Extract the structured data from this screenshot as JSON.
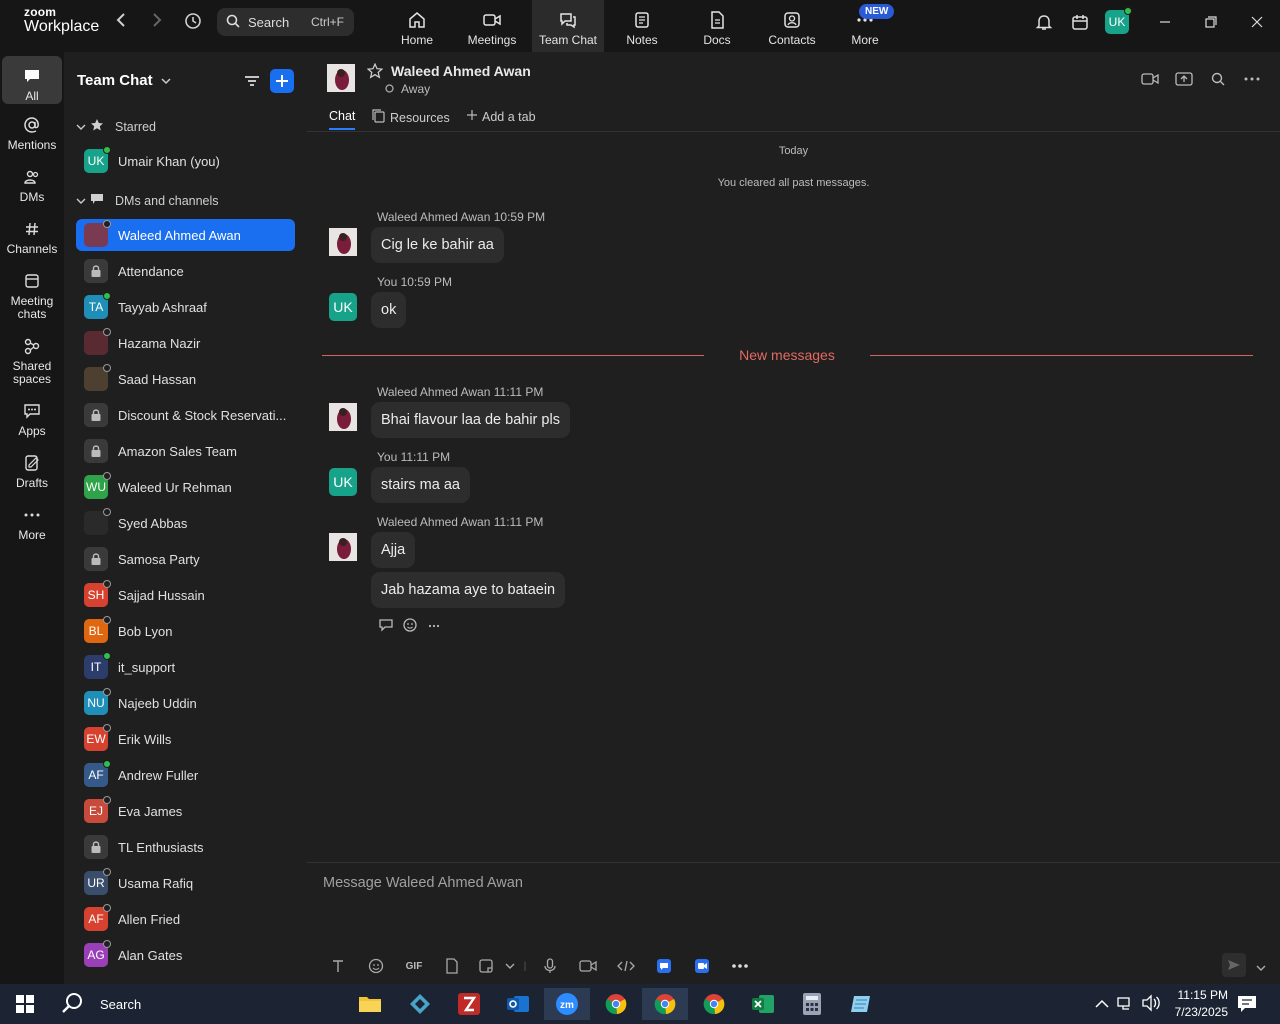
{
  "app": {
    "logo_top": "zoom",
    "logo_bottom": "Workplace",
    "search_label": "Search",
    "search_shortcut": "Ctrl+F",
    "tabs": [
      {
        "label": "Home"
      },
      {
        "label": "Meetings"
      },
      {
        "label": "Team Chat"
      },
      {
        "label": "Notes"
      },
      {
        "label": "Docs"
      },
      {
        "label": "Contacts"
      },
      {
        "label": "More"
      }
    ],
    "new_badge": "NEW",
    "user_initials": "UK"
  },
  "rail": [
    {
      "label": "All"
    },
    {
      "label": "Mentions"
    },
    {
      "label": "DMs"
    },
    {
      "label": "Channels"
    },
    {
      "label": "Meeting chats"
    },
    {
      "label": "Shared spaces"
    },
    {
      "label": "Apps"
    },
    {
      "label": "Drafts"
    },
    {
      "label": "More"
    }
  ],
  "sidebar": {
    "title": "Team Chat",
    "starred_label": "Starred",
    "dms_label": "DMs and channels",
    "starred": [
      {
        "name": "Umair Khan (you)",
        "initials": "UK",
        "color": "#17a28a",
        "status": "on"
      }
    ],
    "items": [
      {
        "name": "Waleed Ahmed Awan",
        "initials": "",
        "color": "#7a3b52",
        "status": "off"
      },
      {
        "name": "Attendance",
        "initials": "",
        "color": "",
        "status": ""
      },
      {
        "name": "Tayyab Ashraaf",
        "initials": "TA",
        "color": "#1f8fb8",
        "status": "on"
      },
      {
        "name": "Hazama Nazir",
        "initials": "",
        "color": "#5a2a33",
        "status": "off"
      },
      {
        "name": "Saad Hassan",
        "initials": "",
        "color": "#4d4030",
        "status": "off"
      },
      {
        "name": "Discount & Stock Reservati...",
        "initials": "",
        "color": "",
        "status": ""
      },
      {
        "name": "Amazon Sales Team",
        "initials": "",
        "color": "",
        "status": ""
      },
      {
        "name": "Waleed Ur Rehman",
        "initials": "WU",
        "color": "#2fa24a",
        "status": "off"
      },
      {
        "name": "Syed Abbas",
        "initials": "",
        "color": "#2a2a2a",
        "status": "off"
      },
      {
        "name": "Samosa Party",
        "initials": "",
        "color": "",
        "status": ""
      },
      {
        "name": "Sajjad Hussain",
        "initials": "SH",
        "color": "#d6422f",
        "status": "off"
      },
      {
        "name": "Bob Lyon",
        "initials": "BL",
        "color": "#e0660f",
        "status": "off"
      },
      {
        "name": "it_support",
        "initials": "IT",
        "color": "#2c3d6b",
        "status": "on"
      },
      {
        "name": "Najeeb Uddin",
        "initials": "NU",
        "color": "#1f8fb8",
        "status": "off"
      },
      {
        "name": "Erik Wills",
        "initials": "EW",
        "color": "#d6422f",
        "status": "off"
      },
      {
        "name": "Andrew Fuller",
        "initials": "AF",
        "color": "#355a8a",
        "status": "on"
      },
      {
        "name": "Eva James",
        "initials": "EJ",
        "color": "#c84a3a",
        "status": "off"
      },
      {
        "name": "TL Enthusiasts",
        "initials": "",
        "color": "",
        "status": ""
      },
      {
        "name": "Usama Rafiq",
        "initials": "UR",
        "color": "#3a4d6b",
        "status": "off"
      },
      {
        "name": "Allen Fried",
        "initials": "AF",
        "color": "#d6422f",
        "status": "off"
      },
      {
        "name": "Alan Gates",
        "initials": "AG",
        "color": "#9b3fb8",
        "status": "off"
      }
    ]
  },
  "chat": {
    "name": "Waleed Ahmed Awan",
    "status": "Away",
    "tabs": [
      {
        "label": "Chat"
      },
      {
        "label": "Resources"
      },
      {
        "label": "Add a tab"
      }
    ],
    "date_label": "Today",
    "cleared_label": "You cleared all past messages.",
    "new_messages_label": "New messages",
    "messages": [
      {
        "meta": "Waleed Ahmed Awan 10:59 PM",
        "texts": [
          "Cig le ke bahir aa"
        ],
        "avatar": "photo"
      },
      {
        "meta": "You 10:59 PM",
        "texts": [
          "ok"
        ],
        "avatar": "UK"
      },
      {
        "meta": "Waleed Ahmed Awan 11:11 PM",
        "texts": [
          "Bhai flavour laa de bahir pls"
        ],
        "avatar": "photo"
      },
      {
        "meta": "You 11:11 PM",
        "texts": [
          "stairs ma aa"
        ],
        "avatar": "UK"
      },
      {
        "meta": "Waleed Ahmed Awan 11:11 PM",
        "texts": [
          "Ajja",
          "Jab hazama aye to bataein"
        ],
        "avatar": "photo"
      }
    ],
    "composer_placeholder": "Message Waleed Ahmed Awan",
    "gif_label": "GIF"
  },
  "taskbar": {
    "search_label": "Search",
    "time": "11:15 PM",
    "date": "7/23/2025"
  },
  "colors": {
    "accent": "#1a6ef0",
    "new_messages": "#e26a61"
  }
}
